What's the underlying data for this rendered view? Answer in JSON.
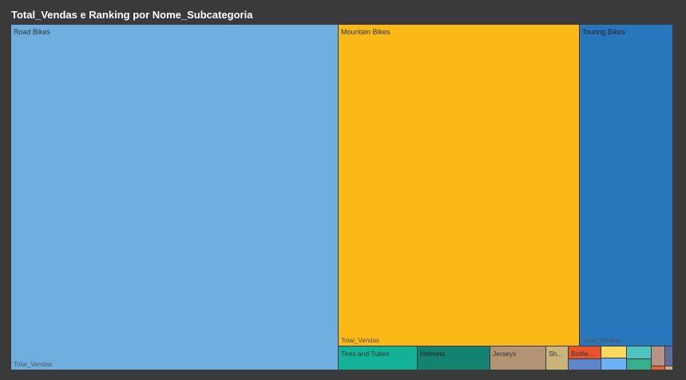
{
  "visual": {
    "title": "Total_Vendas e Ranking por Nome_Subcategoria"
  },
  "chart_data": {
    "type": "treemap",
    "title": "Total_Vendas e Ranking por Nome_Subcategoria",
    "value_label": "Total_Vendas",
    "categories": [
      {
        "name": "Road Bikes",
        "label": "Road Bikes",
        "value": 14520,
        "color": "#6fafe0"
      },
      {
        "name": "Mountain Bikes",
        "label": "Mountain Bikes",
        "value": 9950,
        "color": "#fbb817"
      },
      {
        "name": "Touring Bikes",
        "label": "Touring Bikes",
        "value": 3850,
        "color": "#2877bd"
      },
      {
        "name": "Tires and Tubes",
        "label": "Tires and Tubes",
        "value": 245,
        "color": "#12b296"
      },
      {
        "name": "Helmets",
        "label": "Helmets",
        "value": 225,
        "color": "#138270"
      },
      {
        "name": "Jerseys",
        "label": "Jerseys",
        "value": 170,
        "color": "#b29373"
      },
      {
        "name": "Sh...",
        "label": "Sh...",
        "value": 70,
        "color": "#c9b47e"
      },
      {
        "name": "Bottle...",
        "label": "Bottle...",
        "value": 40,
        "color": "#e8542c"
      },
      {
        "name": "",
        "label": "",
        "value": 18,
        "color": "#5f86c9"
      },
      {
        "name": "",
        "label": "",
        "value": 30,
        "color": "#fbd85c"
      },
      {
        "name": "",
        "label": "",
        "value": 18,
        "color": "#6cb1f5"
      },
      {
        "name": "",
        "label": "",
        "value": 28,
        "color": "#4fc3be"
      },
      {
        "name": "",
        "label": "",
        "value": 16,
        "color": "#39ae8c"
      },
      {
        "name": "",
        "label": "",
        "value": 20,
        "color": "#b79387"
      },
      {
        "name": "",
        "label": "",
        "value": 8,
        "color": "#e8652c"
      },
      {
        "name": "",
        "label": "",
        "value": 8,
        "color": "#5f6b9a"
      },
      {
        "name": "",
        "label": "",
        "value": 10,
        "color": "#c6af87"
      }
    ]
  }
}
